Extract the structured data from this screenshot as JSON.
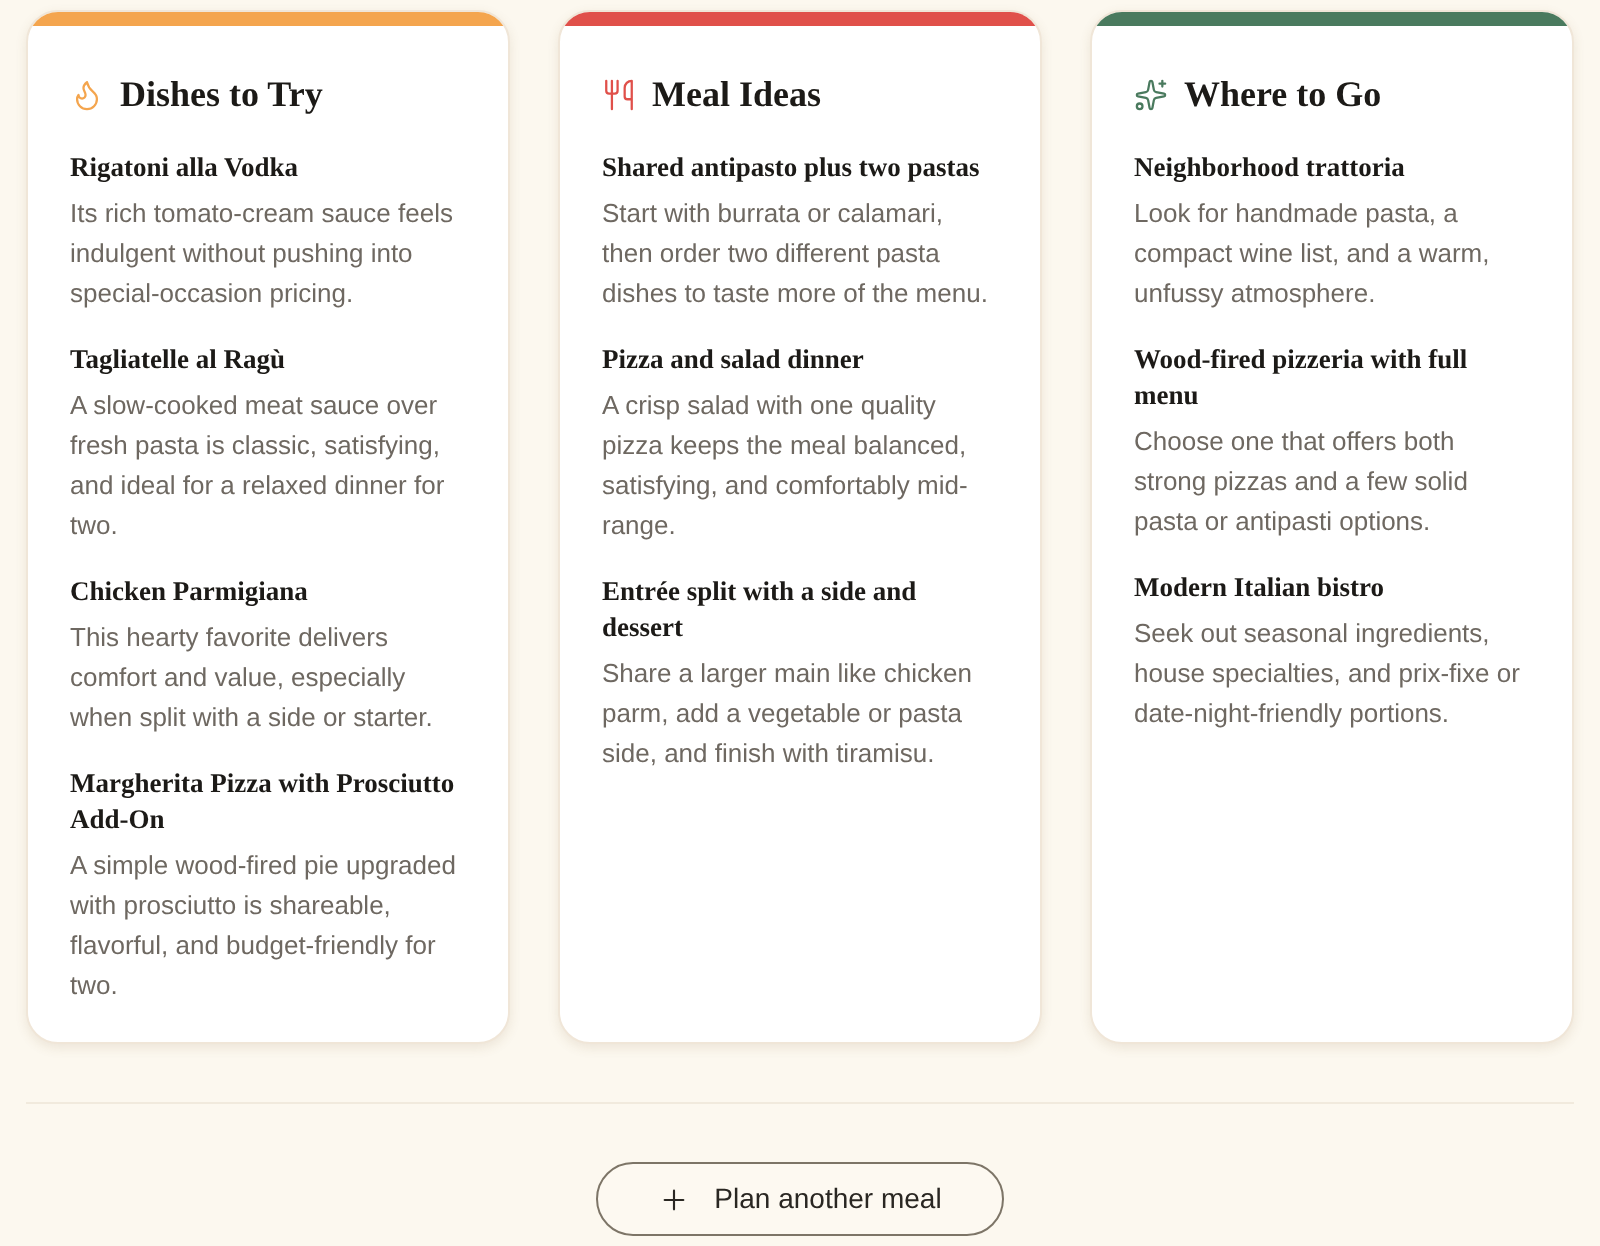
{
  "cards": [
    {
      "title": "Dishes to Try",
      "color": "#f4a54e",
      "items": [
        {
          "name": "Rigatoni alla Vodka",
          "description": "Its rich tomato-cream sauce feels indulgent without pushing into special-occasion pricing."
        },
        {
          "name": "Tagliatelle al Ragù",
          "description": "A slow-cooked meat sauce over fresh pasta is classic, satisfying, and ideal for a relaxed dinner for two."
        },
        {
          "name": "Chicken Parmigiana",
          "description": "This hearty favorite delivers comfort and value, especially when split with a side or starter."
        },
        {
          "name": "Margherita Pizza with Prosciutto Add-On",
          "description": "A simple wood-fired pie upgraded with prosciutto is shareable, flavorful, and budget-friendly for two."
        }
      ]
    },
    {
      "title": "Meal Ideas",
      "color": "#e0504a",
      "items": [
        {
          "name": "Shared antipasto plus two pastas",
          "description": "Start with burrata or calamari, then order two different pasta dishes to taste more of the menu."
        },
        {
          "name": "Pizza and salad dinner",
          "description": "A crisp salad with one quality pizza keeps the meal balanced, satisfying, and comfortably mid-range."
        },
        {
          "name": "Entrée split with a side and dessert",
          "description": "Share a larger main like chicken parm, add a vegetable or pasta side, and finish with tiramisu."
        }
      ]
    },
    {
      "title": "Where to Go",
      "color": "#4a7a5e",
      "items": [
        {
          "name": "Neighborhood trattoria",
          "description": "Look for handmade pasta, a compact wine list, and a warm, unfussy atmosphere."
        },
        {
          "name": "Wood-fired pizzeria with full menu",
          "description": "Choose one that offers both strong pizzas and a few solid pasta or antipasti options."
        },
        {
          "name": "Modern Italian bistro",
          "description": "Seek out seasonal ingredients, house specialties, and prix-fixe or date-night-friendly portions."
        }
      ]
    }
  ],
  "action_button": {
    "label": "Plan another meal"
  }
}
